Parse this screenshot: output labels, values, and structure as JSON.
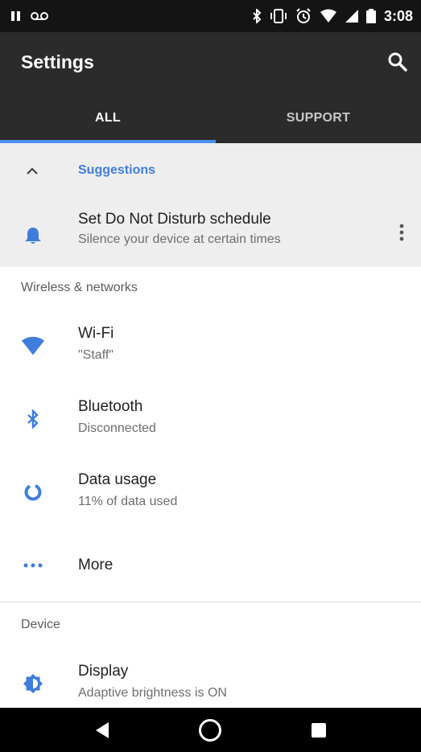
{
  "status_bar": {
    "time": "3:08",
    "icons": [
      "pause-icon",
      "voicemail-icon",
      "bluetooth-icon",
      "vibrate-icon",
      "alarm-icon",
      "wifi-icon",
      "signal-icon",
      "battery-icon"
    ]
  },
  "app_bar": {
    "title": "Settings",
    "search_icon": "search-icon",
    "tabs": [
      {
        "label": "ALL",
        "active": true
      },
      {
        "label": "SUPPORT",
        "active": false
      }
    ]
  },
  "colors": {
    "accent": "#4a90f0",
    "suggestion_text": "#3f7ddb",
    "app_bar": "#2b2b2b",
    "status_bar": "#141414"
  },
  "suggestions": {
    "title": "Suggestions",
    "items": [
      {
        "icon": "bell-icon",
        "title": "Set Do Not Disturb schedule",
        "subtitle": "Silence your device at certain times"
      }
    ]
  },
  "sections": [
    {
      "header": "Wireless & networks",
      "items": [
        {
          "icon": "wifi-icon",
          "title": "Wi-Fi",
          "subtitle": "\"Staff\""
        },
        {
          "icon": "bluetooth-icon",
          "title": "Bluetooth",
          "subtitle": "Disconnected"
        },
        {
          "icon": "data-usage-icon",
          "title": "Data usage",
          "subtitle": "11% of data used"
        },
        {
          "icon": "more-dots-icon",
          "title": "More"
        }
      ]
    },
    {
      "header": "Device",
      "items": [
        {
          "icon": "brightness-icon",
          "title": "Display",
          "subtitle": "Adaptive brightness is ON"
        }
      ]
    }
  ],
  "nav_bar": [
    "back-icon",
    "home-icon",
    "recents-icon"
  ]
}
